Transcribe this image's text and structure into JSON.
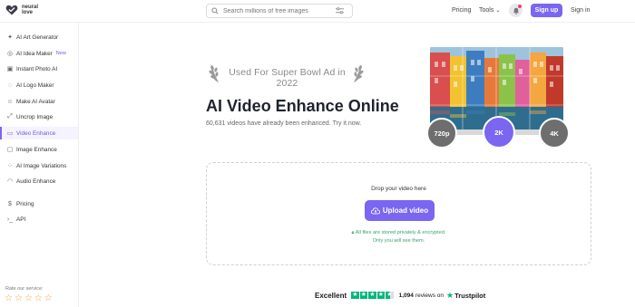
{
  "header": {
    "logo_text": "neural love",
    "search_placeholder": "Search millions of free images",
    "pricing": "Pricing",
    "tools": "Tools",
    "signup": "Sign up",
    "signin": "Sign in",
    "accent": "#7a66f0"
  },
  "sidebar": {
    "items": [
      {
        "label": "AI Art Generator",
        "icon": "ai-art-icon"
      },
      {
        "label": "AI Idea Maker",
        "icon": "idea-icon",
        "badge": "New"
      },
      {
        "label": "Instant Photo AI",
        "icon": "photo-icon"
      },
      {
        "label": "AI Logo Maker",
        "icon": "logo-icon"
      },
      {
        "label": "Make AI Avatar",
        "icon": "avatar-icon"
      },
      {
        "label": "Uncrop Image",
        "icon": "uncrop-icon"
      },
      {
        "label": "Video Enhance",
        "icon": "video-icon",
        "active": true
      },
      {
        "label": "Image Enhance",
        "icon": "image-icon"
      },
      {
        "label": "AI Image Variations",
        "icon": "variations-icon"
      },
      {
        "label": "Audio Enhance",
        "icon": "audio-icon"
      },
      {
        "label": "Pricing",
        "icon": "dollar-icon"
      },
      {
        "label": "API",
        "icon": "api-icon"
      }
    ],
    "rate_label": "Rate our service:",
    "star_count": 5
  },
  "hero": {
    "laurel_text": "Used For Super Bowl Ad in 2022",
    "title": "AI Video Enhance Online",
    "subtitle": "60,631 videos have already been enhanced. Try it now.",
    "resolutions": [
      "720p",
      "2K",
      "4K"
    ],
    "selected_resolution": "2K"
  },
  "upload": {
    "drop_text": "Drop your video here",
    "button": "Upload video",
    "secure_line1": "All files are stored privately & encrypted.",
    "secure_line2": "Only you will see them."
  },
  "trustpilot": {
    "rating_word": "Excellent",
    "review_count": "1,094",
    "reviews_on": "reviews on",
    "brand": "Trustpilot",
    "brand_color": "#00b67a"
  }
}
